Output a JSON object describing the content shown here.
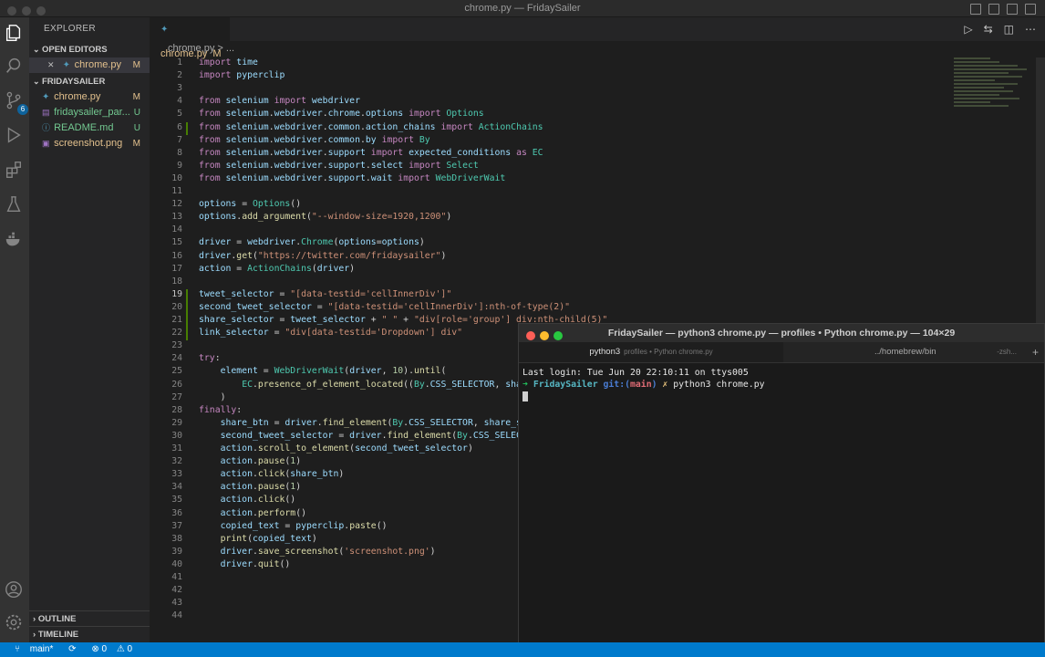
{
  "window": {
    "title": "chrome.py — FridaySailer"
  },
  "activity_bar": {
    "scm_badge": "6"
  },
  "explorer": {
    "title": "EXPLORER",
    "open_editors": {
      "label": "OPEN EDITORS",
      "items": [
        {
          "close": "✕",
          "name": "chrome.py",
          "status": "M"
        }
      ]
    },
    "project": {
      "label": "FRIDAYSAILER",
      "files": [
        {
          "name": "chrome.py",
          "status": "M"
        },
        {
          "name": "fridaysailer_par...",
          "status": "U"
        },
        {
          "name": "README.md",
          "status": "U"
        },
        {
          "name": "screenshot.png",
          "status": "M"
        }
      ]
    },
    "outline": "OUTLINE",
    "timeline": "TIMELINE"
  },
  "editor": {
    "tab": {
      "name": "chrome.py",
      "status": "M"
    },
    "breadcrumb": "chrome.py > ...",
    "lines": [
      {
        "n": "1",
        "t": "import time"
      },
      {
        "n": "2",
        "t": "import pyperclip"
      },
      {
        "n": "3",
        "t": ""
      },
      {
        "n": "4",
        "t": "from selenium import webdriver"
      },
      {
        "n": "5",
        "t": "from selenium.webdriver.chrome.options import Options"
      },
      {
        "n": "6",
        "t": "from selenium.webdriver.common.action_chains import ActionChains"
      },
      {
        "n": "7",
        "t": "from selenium.webdriver.common.by import By"
      },
      {
        "n": "8",
        "t": "from selenium.webdriver.support import expected_conditions as EC"
      },
      {
        "n": "9",
        "t": "from selenium.webdriver.support.select import Select"
      },
      {
        "n": "10",
        "t": "from selenium.webdriver.support.wait import WebDriverWait"
      },
      {
        "n": "11",
        "t": ""
      },
      {
        "n": "12",
        "t": "options = Options()"
      },
      {
        "n": "13",
        "t": "options.add_argument(\"--window-size=1920,1200\")"
      },
      {
        "n": "14",
        "t": ""
      },
      {
        "n": "15",
        "t": "driver = webdriver.Chrome(options=options)"
      },
      {
        "n": "16",
        "t": "driver.get(\"https://twitter.com/fridaysailer\")"
      },
      {
        "n": "17",
        "t": "action = ActionChains(driver)"
      },
      {
        "n": "18",
        "t": ""
      },
      {
        "n": "19",
        "t": "tweet_selector = \"[data-testid='cellInnerDiv']\""
      },
      {
        "n": "20",
        "t": "second_tweet_selector = \"[data-testid='cellInnerDiv']:nth-of-type(2)\""
      },
      {
        "n": "21",
        "t": "share_selector = tweet_selector + \" \" + \"div[role='group'] div:nth-child(5)\""
      },
      {
        "n": "22",
        "t": "link_selector = \"div[data-testid='Dropdown'] div\""
      },
      {
        "n": "23",
        "t": ""
      },
      {
        "n": "24",
        "t": "try:"
      },
      {
        "n": "25",
        "t": "    element = WebDriverWait(driver, 10).until("
      },
      {
        "n": "26",
        "t": "        EC.presence_of_element_located((By.CSS_SELECTOR, share"
      },
      {
        "n": "27",
        "t": "    )"
      },
      {
        "n": "28",
        "t": "finally:"
      },
      {
        "n": "29",
        "t": "    share_btn = driver.find_element(By.CSS_SELECTOR, share_sel"
      },
      {
        "n": "30",
        "t": "    second_tweet_selector = driver.find_element(By.CSS_SELECTOR"
      },
      {
        "n": "31",
        "t": "    action.scroll_to_element(second_tweet_selector)"
      },
      {
        "n": "32",
        "t": "    action.pause(1)"
      },
      {
        "n": "33",
        "t": "    action.click(share_btn)"
      },
      {
        "n": "34",
        "t": "    action.pause(1)"
      },
      {
        "n": "35",
        "t": "    action.click()"
      },
      {
        "n": "36",
        "t": "    action.perform()"
      },
      {
        "n": "37",
        "t": "    copied_text = pyperclip.paste()"
      },
      {
        "n": "38",
        "t": "    print(copied_text)"
      },
      {
        "n": "39",
        "t": "    driver.save_screenshot('screenshot.png')"
      },
      {
        "n": "40",
        "t": "    driver.quit()"
      },
      {
        "n": "41",
        "t": ""
      },
      {
        "n": "42",
        "t": ""
      },
      {
        "n": "43",
        "t": ""
      },
      {
        "n": "44",
        "t": ""
      }
    ]
  },
  "terminal": {
    "title": "FridaySailer — python3 chrome.py — profiles • Python chrome.py — 104×29",
    "tab1": "python3",
    "tab1_sub": "profiles • Python chrome.py",
    "tab2": "../homebrew/bin",
    "tab2_sub": "-zsh...",
    "plus": "+",
    "last_login": "Last login: Tue Jun 20 22:10:11 on ttys005",
    "prompt_arrow": "➜",
    "prompt_dir": "FridaySailer",
    "prompt_git": "git:(",
    "prompt_branch": "main",
    "prompt_git_end": ")",
    "prompt_x": "✗",
    "command": "python3 chrome.py"
  },
  "status_bar": {
    "branch": "main*",
    "sync": "⟳",
    "errors": "⊗ 0",
    "warnings": "⚠ 0"
  }
}
